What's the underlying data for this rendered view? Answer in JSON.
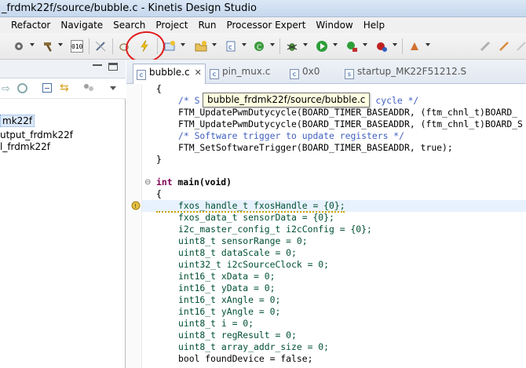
{
  "window": {
    "title": "_frdmk22f/source/bubble.c - Kinetis Design Studio"
  },
  "menu": {
    "items": [
      "Refactor",
      "Navigate",
      "Search",
      "Project",
      "Run",
      "Processor Expert",
      "Window",
      "Help"
    ]
  },
  "toolbar": {
    "icons": [
      "gear-icon",
      "hammer-icon",
      "binary-icon",
      "link-icon",
      "debug-flash-icon",
      "lightning-icon",
      "new-project-icon",
      "new-folder-icon",
      "new-file-icon",
      "new-class-icon",
      "debug-icon",
      "run-icon",
      "external-tool-icon",
      "record-icon",
      "pen-icon"
    ],
    "accent_circle_color": "#e01c1c"
  },
  "left_panel": {
    "tree": [
      {
        "label": "mk22f",
        "selected": true
      },
      {
        "label": "utput_frdmk22f",
        "selected": false
      },
      {
        "label": "l_frdmk22f",
        "selected": false
      }
    ]
  },
  "editor": {
    "tabs": [
      {
        "label": "bubble.c",
        "active": true,
        "icon": "c"
      },
      {
        "label": "pin_mux.c",
        "active": false,
        "icon": "c"
      },
      {
        "label": "0x0",
        "active": false,
        "icon": "c"
      },
      {
        "label": "startup_MK22F51212.S",
        "active": false,
        "icon": "s"
      }
    ],
    "tooltip": "bubble_frdmk22f/source/bubble.c",
    "code": {
      "l1": "{",
      "l2": "/* S",
      "l2b": "uty cycle */",
      "l3": "FTM_UpdatePwmDutycycle(BOARD_TIMER_BASEADDR, (ftm_chnl_t)BOARD_",
      "l4": "FTM_UpdatePwmDutycycle(BOARD_TIMER_BASEADDR, (ftm_chnl_t)BOARD_S",
      "l5": "/* Software trigger to update registers */",
      "l6": "FTM_SetSoftwareTrigger(BOARD_TIMER_BASEADDR, true);",
      "l7": "}",
      "main_kw": "int",
      "main_rest": " main(void)",
      "l9": "{",
      "l10": "fxos_handle_t fxosHandle = {0};",
      "l11": "fxos_data_t sensorData = {0};",
      "l12": "i2c_master_config_t i2cConfig = {0};",
      "l13": "uint8_t sensorRange = 0;",
      "l14": "uint8_t dataScale = 0;",
      "l15": "uint32_t i2cSourceClock = 0;",
      "l16": "int16_t xData = 0;",
      "l17": "int16_t yData = 0;",
      "l18": "int16_t xAngle = 0;",
      "l19": "int16_t yAngle = 0;",
      "l20": "uint8_t i = 0;",
      "l21": "uint8_t regResult = 0;",
      "l22": "uint8_t array_addr_size = 0;",
      "l23": "bool foundDevice = false;"
    }
  }
}
